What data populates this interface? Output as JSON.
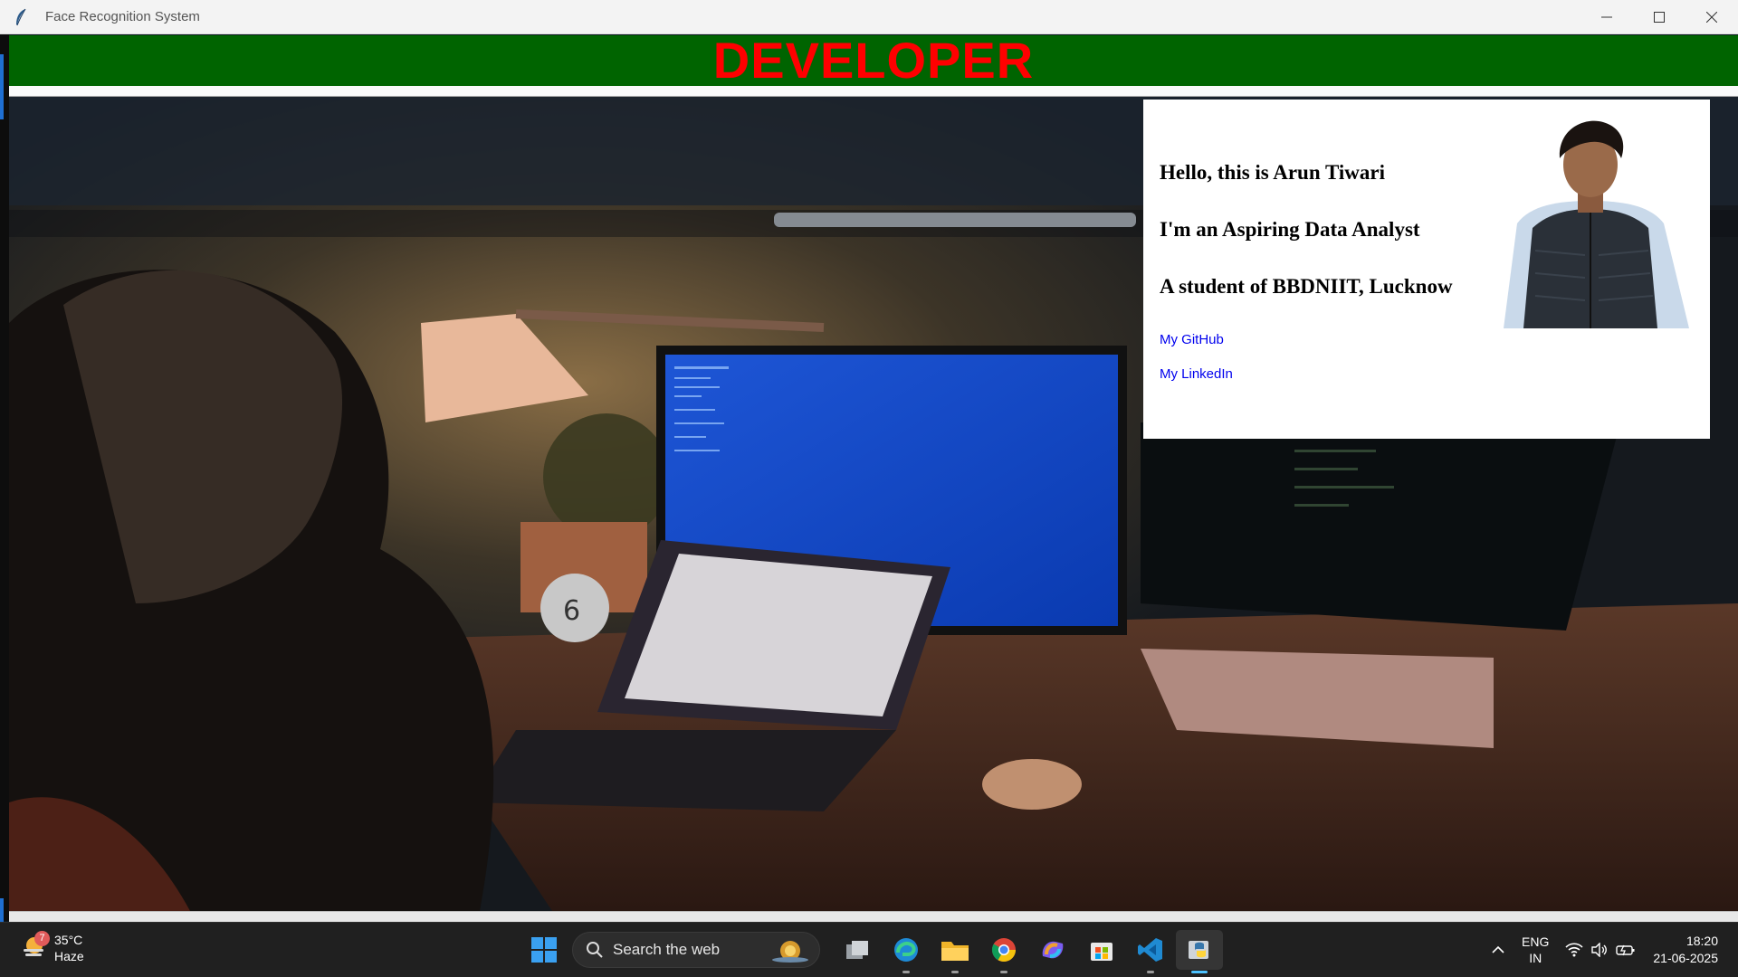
{
  "window": {
    "title": "Face Recognition System",
    "controls": [
      "minimize-icon",
      "maximize-icon",
      "close-icon"
    ]
  },
  "header": {
    "title": "DEVELOPER",
    "bg_color": "#006400",
    "title_color": "#ff0000"
  },
  "card": {
    "lines": [
      "Hello, this is Arun Tiwari",
      "I'm an Aspiring Data Analyst",
      "A student of BBDNIIT, Lucknow"
    ],
    "links": {
      "github": "My GitHub",
      "linkedin": "My LinkedIn"
    }
  },
  "taskbar": {
    "weather": {
      "temp": "35°C",
      "condition": "Haze",
      "badge": "7"
    },
    "search_placeholder": "Search the web",
    "apps": [
      "task-view-icon",
      "edge-icon",
      "file-explorer-icon",
      "chrome-icon",
      "copilot-icon",
      "store-icon",
      "vscode-icon",
      "python-icon"
    ],
    "tray": {
      "lang_line1": "ENG",
      "lang_line2": "IN",
      "time": "18:20",
      "date": "21-06-2025"
    }
  }
}
